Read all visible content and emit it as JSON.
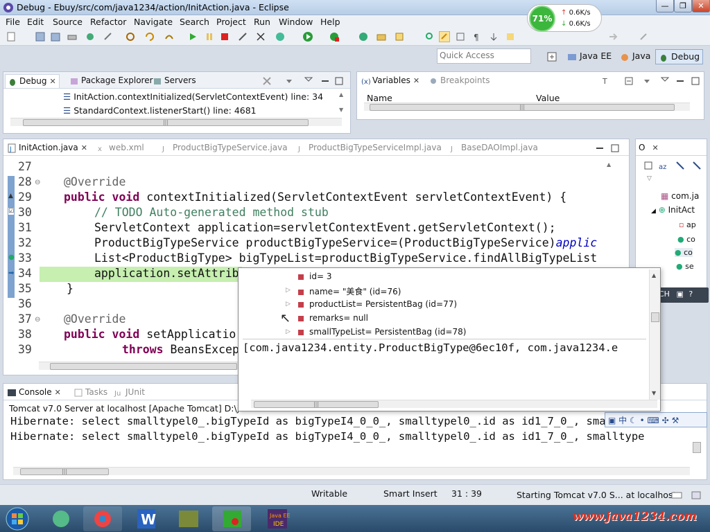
{
  "window": {
    "title": "Debug - Ebuy/src/com/java1234/action/InitAction.java - Eclipse",
    "min": "—",
    "restore": "❐",
    "close": "✕"
  },
  "menu": [
    "File",
    "Edit",
    "Source",
    "Refactor",
    "Navigate",
    "Search",
    "Project",
    "Run",
    "Window",
    "Help"
  ],
  "netmon": {
    "percent": "71%",
    "up": "0.6K/s",
    "down": "0.6K/s"
  },
  "quick_access": {
    "placeholder": "Quick Access"
  },
  "perspectives": [
    "Java EE",
    "Java",
    "Debug"
  ],
  "debug_view": {
    "tabs": [
      "Debug",
      "Package Explorer",
      "Servers"
    ],
    "frames": [
      "InitAction.contextInitialized(ServletContextEvent) line: 34",
      "StandardContext.listenerStart() line: 4681"
    ]
  },
  "variables_view": {
    "tabs": [
      "Variables",
      "Breakpoints"
    ],
    "columns": [
      "Name",
      "Value"
    ]
  },
  "editor": {
    "tabs": [
      "InitAction.java",
      "web.xml",
      "ProductBigTypeService.java",
      "ProductBigTypeServiceImpl.java",
      "BaseDAOImpl.java"
    ],
    "lines": [
      {
        "n": "27",
        "t": ""
      },
      {
        "n": "28",
        "ann": "@Override"
      },
      {
        "n": "29",
        "kw": "public void",
        "t": " contextInitialized(ServletContextEvent servletContextEvent) {"
      },
      {
        "n": "30",
        "cm": "// TODO Auto-generated method stub"
      },
      {
        "n": "31",
        "t": "ServletContext application=servletContextEvent.getServletContext();"
      },
      {
        "n": "32",
        "t": "ProductBigTypeService productBigTypeService=(ProductBigTypeService)",
        "fld": "applic"
      },
      {
        "n": "33",
        "t": "List<ProductBigType> bigTypeList=productBigTypeService.findAllBigTypeList"
      },
      {
        "n": "34",
        "t": "application.setAttrib"
      },
      {
        "n": "35",
        "t": "}"
      },
      {
        "n": "36",
        "t": ""
      },
      {
        "n": "37",
        "ann": "@Override"
      },
      {
        "n": "38",
        "kw": "public void",
        "t": " setApplicatio"
      },
      {
        "n": "39",
        "kw": "throws",
        "t": " BeansExcep"
      }
    ]
  },
  "outline": {
    "tab": "O",
    "items": [
      "com.ja",
      "InitAct",
      "ap",
      "co",
      "co",
      "se"
    ]
  },
  "hover": {
    "nodes": [
      "id= 3",
      "name= \"美食\" (id=76)",
      "productList= PersistentBag  (id=77)",
      "remarks= null",
      "smallTypeList= PersistentBag  (id=78)"
    ],
    "detail": "[com.java1234.entity.ProductBigType@6ec10f, com.java1234.e"
  },
  "ime": {
    "lang": "CH",
    "icon_text": "中"
  },
  "console": {
    "tabs": [
      "Console",
      "Tasks",
      "JUnit"
    ],
    "header": "Tomcat v7.0 Server at localhost [Apache Tomcat] D:\\jdk1",
    "lines": [
      "Hibernate: select smalltypel0_.bigTypeId as bigTypeI4_0_0_, smalltypel0_.id as id1_7_0_, smalltype",
      "Hibernate: select smalltypel0_.bigTypeId as bigTypeI4_0_0_, smalltypel0_.id as id1_7_0_, smalltype"
    ]
  },
  "status": {
    "writable": "Writable",
    "insert": "Smart Insert",
    "pos": "31 : 39",
    "job": "Starting Tomcat v7.0 S... at localhost"
  },
  "watermark": "www.java1234.com",
  "colors": {
    "accent": "#3399ff",
    "current_line": "#c6efb0",
    "keyword": "#7f0055"
  }
}
